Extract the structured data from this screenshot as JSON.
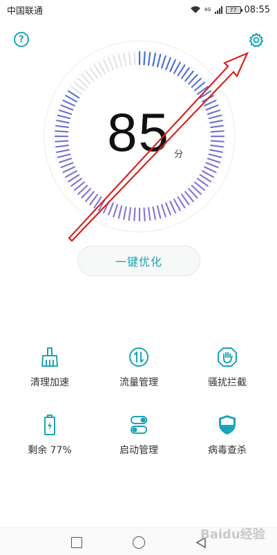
{
  "status_bar": {
    "carrier": "中国联通",
    "network_type": "4G",
    "battery_level": "77",
    "time": "08:55"
  },
  "header": {
    "help_icon": "question-circle-icon",
    "settings_icon": "gear-icon"
  },
  "score": {
    "value": "85",
    "unit": "分",
    "gauge_fraction": 0.85
  },
  "optimize_button": {
    "label": "一键优化"
  },
  "tools": [
    {
      "label": "清理加速",
      "icon": "broom-icon"
    },
    {
      "label": "流量管理",
      "icon": "data-traffic-icon"
    },
    {
      "label": "骚扰拦截",
      "icon": "block-hand-icon"
    },
    {
      "label": "剩余 77%",
      "icon": "battery-icon"
    },
    {
      "label": "启动管理",
      "icon": "startup-toggle-icon"
    },
    {
      "label": "病毒查杀",
      "icon": "shield-icon"
    }
  ],
  "colors": {
    "accent": "#19a3b4",
    "gauge_blue": "#3f6fcf",
    "gauge_purple": "#8a78d2",
    "gauge_inactive": "#e3e3e3",
    "annotation_arrow": "#d8221d"
  },
  "nav_bar": {
    "icons": [
      "recent-apps-icon",
      "home-icon",
      "back-icon"
    ]
  },
  "watermark": "Baidu经验"
}
